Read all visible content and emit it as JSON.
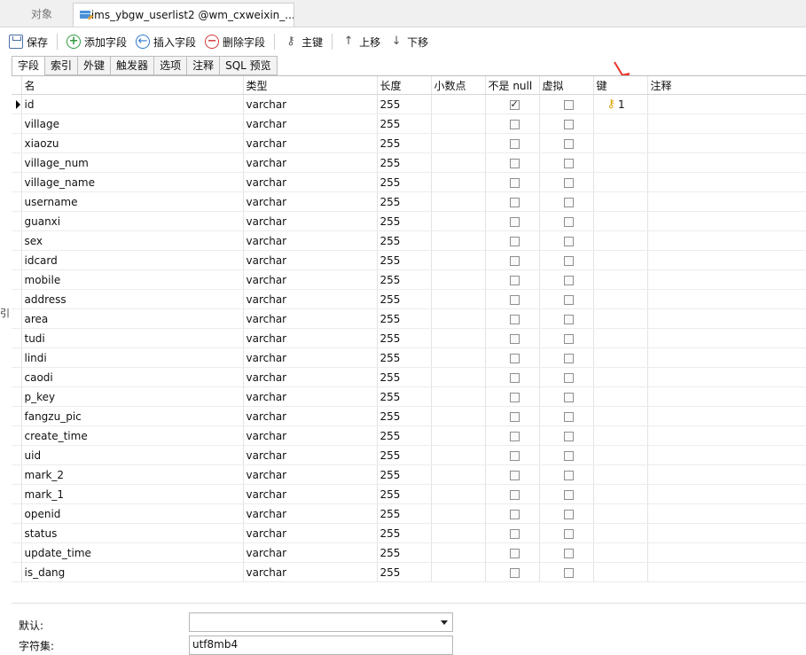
{
  "top_tabs": {
    "objects": "对象",
    "document": "* ims_ybgw_userlist2 @wm_cxweixin_..."
  },
  "toolbar": {
    "save": "保存",
    "add_field": "添加字段",
    "insert_field": "插入字段",
    "delete_field": "删除字段",
    "primary_key": "主键",
    "move_up": "上移",
    "move_down": "下移"
  },
  "sub_tabs": [
    "字段",
    "索引",
    "外键",
    "触发器",
    "选项",
    "注释",
    "SQL 预览"
  ],
  "columns": {
    "name": "名",
    "type": "类型",
    "length": "长度",
    "decimals": "小数点",
    "not_null": "不是 null",
    "virtual": "虚拟",
    "key": "键",
    "comment": "注释"
  },
  "rows": [
    {
      "name": "id",
      "type": "varchar",
      "length": "255",
      "not_null": true,
      "key": "1"
    },
    {
      "name": "village",
      "type": "varchar",
      "length": "255",
      "not_null": false,
      "key": ""
    },
    {
      "name": "xiaozu",
      "type": "varchar",
      "length": "255",
      "not_null": false,
      "key": ""
    },
    {
      "name": "village_num",
      "type": "varchar",
      "length": "255",
      "not_null": false,
      "key": ""
    },
    {
      "name": "village_name",
      "type": "varchar",
      "length": "255",
      "not_null": false,
      "key": ""
    },
    {
      "name": "username",
      "type": "varchar",
      "length": "255",
      "not_null": false,
      "key": ""
    },
    {
      "name": "guanxi",
      "type": "varchar",
      "length": "255",
      "not_null": false,
      "key": ""
    },
    {
      "name": "sex",
      "type": "varchar",
      "length": "255",
      "not_null": false,
      "key": ""
    },
    {
      "name": "idcard",
      "type": "varchar",
      "length": "255",
      "not_null": false,
      "key": ""
    },
    {
      "name": "mobile",
      "type": "varchar",
      "length": "255",
      "not_null": false,
      "key": ""
    },
    {
      "name": "address",
      "type": "varchar",
      "length": "255",
      "not_null": false,
      "key": ""
    },
    {
      "name": "area",
      "type": "varchar",
      "length": "255",
      "not_null": false,
      "key": ""
    },
    {
      "name": "tudi",
      "type": "varchar",
      "length": "255",
      "not_null": false,
      "key": ""
    },
    {
      "name": "lindi",
      "type": "varchar",
      "length": "255",
      "not_null": false,
      "key": ""
    },
    {
      "name": "caodi",
      "type": "varchar",
      "length": "255",
      "not_null": false,
      "key": ""
    },
    {
      "name": "p_key",
      "type": "varchar",
      "length": "255",
      "not_null": false,
      "key": ""
    },
    {
      "name": "fangzu_pic",
      "type": "varchar",
      "length": "255",
      "not_null": false,
      "key": ""
    },
    {
      "name": "create_time",
      "type": "varchar",
      "length": "255",
      "not_null": false,
      "key": ""
    },
    {
      "name": "uid",
      "type": "varchar",
      "length": "255",
      "not_null": false,
      "key": ""
    },
    {
      "name": "mark_2",
      "type": "varchar",
      "length": "255",
      "not_null": false,
      "key": ""
    },
    {
      "name": "mark_1",
      "type": "varchar",
      "length": "255",
      "not_null": false,
      "key": ""
    },
    {
      "name": "openid",
      "type": "varchar",
      "length": "255",
      "not_null": false,
      "key": ""
    },
    {
      "name": "status",
      "type": "varchar",
      "length": "255",
      "not_null": false,
      "key": ""
    },
    {
      "name": "update_time",
      "type": "varchar",
      "length": "255",
      "not_null": false,
      "key": ""
    },
    {
      "name": "is_dang",
      "type": "varchar",
      "length": "255",
      "not_null": false,
      "key": ""
    }
  ],
  "properties": {
    "default_label": "默认:",
    "default_value": "",
    "charset_label": "字符集:",
    "charset_value": "utf8mb4"
  },
  "left_stub": "引",
  "colors": {
    "annotation_arrow": "#e8332a",
    "key_icon": "#d9a200"
  },
  "icons": [
    "document-table-icon",
    "save-icon",
    "add-circle-icon",
    "insert-circle-icon",
    "delete-circle-icon",
    "key-icon",
    "arrow-up-icon",
    "arrow-down-icon",
    "row-pointer-icon",
    "red-arrow-annotation"
  ]
}
